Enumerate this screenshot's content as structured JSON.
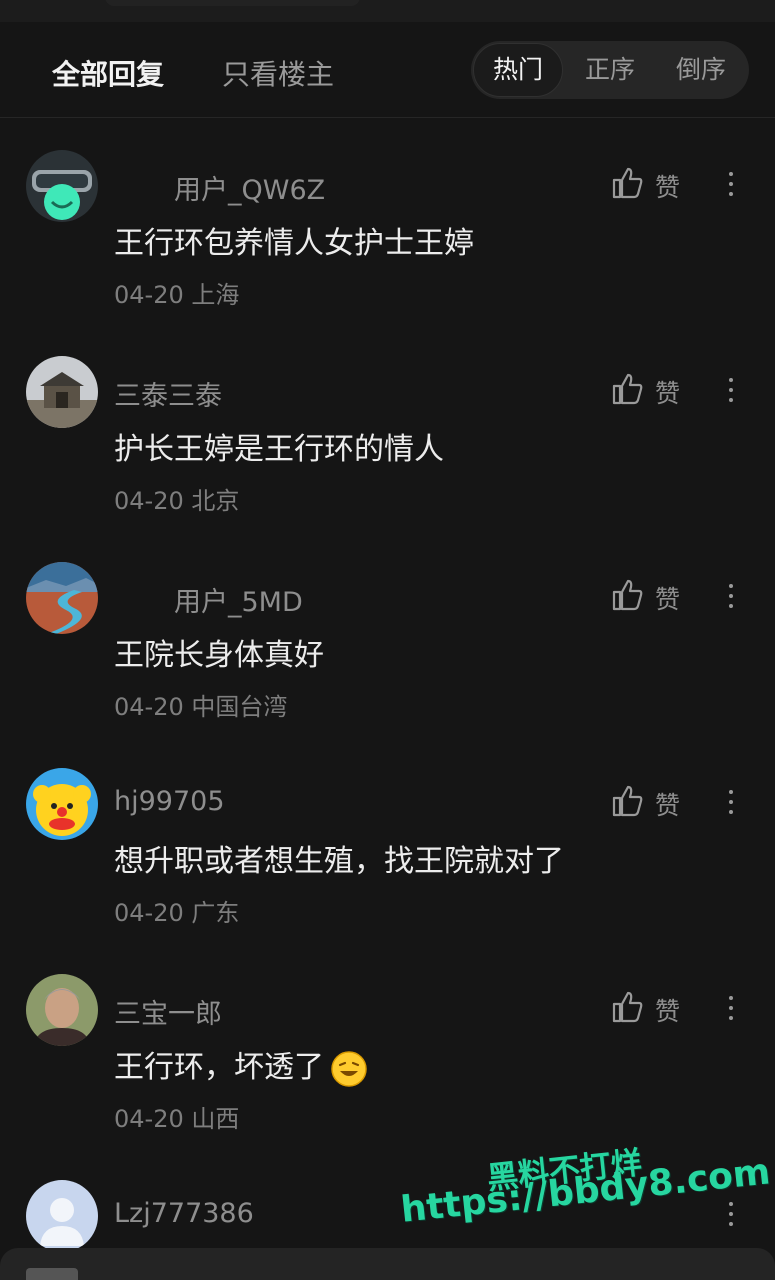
{
  "header": {
    "tab_all": "全部回复",
    "tab_op_only": "只看楼主",
    "sort": {
      "hot": "热门",
      "asc": "正序",
      "desc": "倒序"
    }
  },
  "like_label": "赞",
  "comments": [
    {
      "username": "用户_QW6Z",
      "text": "王行环包养情人女护士王婷",
      "date": "04-20",
      "location": "上海",
      "avatar": "vr-headset-avatar"
    },
    {
      "username": "三泰三泰",
      "text": "护长王婷是王行环的情人",
      "date": "04-20",
      "location": "北京",
      "avatar": "gate-building-avatar"
    },
    {
      "username": "用户_5MD",
      "text": "王院长身体真好",
      "date": "04-20",
      "location": "中国台湾",
      "avatar": "river-landscape-avatar"
    },
    {
      "username": "hj99705",
      "text": "想升职或者想生殖，找王院就对了",
      "date": "04-20",
      "location": "广东",
      "avatar": "clown-avatar"
    },
    {
      "username": "三宝一郎",
      "text": "王行环，坏透了",
      "emoji": "grinning-face-emoji",
      "date": "04-20",
      "location": "山西",
      "avatar": "man-portrait-avatar"
    },
    {
      "username": "Lzj777386",
      "avatar": "default-user-avatar"
    }
  ],
  "watermark": {
    "line1": "黑料不打烊",
    "line2": "https://bbdy8.com"
  },
  "colors": {
    "background": "#151515",
    "watermark": "#27d6a0",
    "text_primary": "#ececec",
    "text_secondary": "#8e8e8e"
  }
}
